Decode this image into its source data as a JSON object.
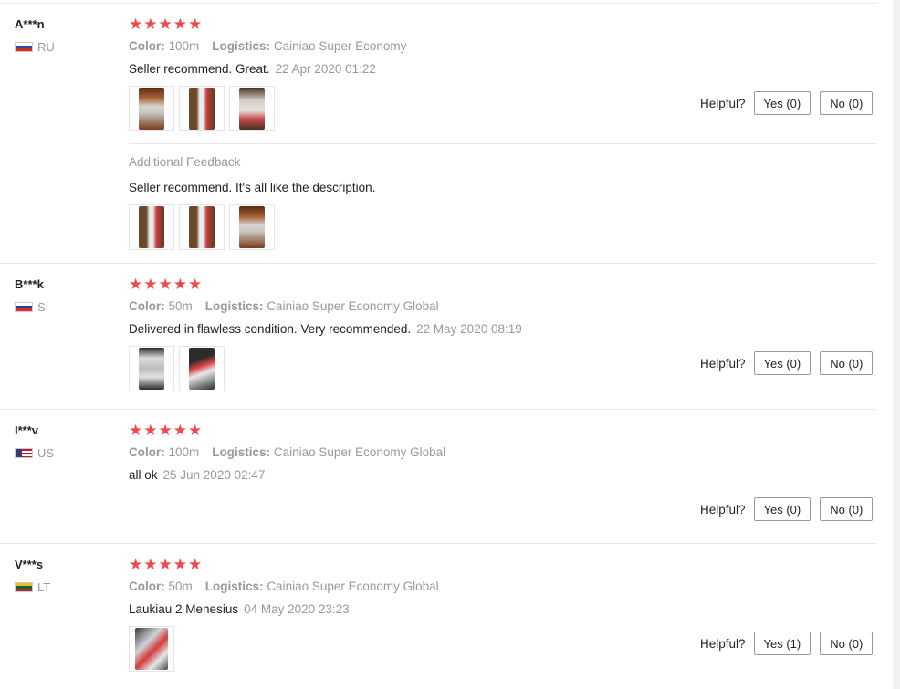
{
  "labels": {
    "color": "Color:",
    "logistics": "Logistics:",
    "helpful": "Helpful?",
    "additional_feedback": "Additional Feedback"
  },
  "stars_glyph": "★★★★★",
  "reviews": [
    {
      "user": "A***n",
      "country": "RU",
      "rating": 5,
      "color": "100m",
      "logistics": "Cainiao Super Economy",
      "text": "Seller recommend. Great.",
      "date": "22 Apr 2020 01:22",
      "yes": "Yes (0)",
      "no": "No (0)",
      "additional_text": "Seller recommend. It's all like the description."
    },
    {
      "user": "B***k",
      "country": "SI",
      "rating": 5,
      "color": "50m",
      "logistics": "Cainiao Super Economy Global",
      "text": "Delivered in flawless condition. Very recommended.",
      "date": "22 May 2020 08:19",
      "yes": "Yes (0)",
      "no": "No (0)"
    },
    {
      "user": "I***v",
      "country": "US",
      "rating": 5,
      "color": "100m",
      "logistics": "Cainiao Super Economy Global",
      "text": "all ok",
      "date": "25 Jun 2020 02:47",
      "yes": "Yes (0)",
      "no": "No (0)"
    },
    {
      "user": "V***s",
      "country": "LT",
      "rating": 5,
      "color": "50m",
      "logistics": "Cainiao Super Economy Global",
      "text": "Laukiau 2 Menesius",
      "date": "04 May 2020 23:23",
      "yes": "Yes (1)",
      "no": "No (0)"
    }
  ]
}
